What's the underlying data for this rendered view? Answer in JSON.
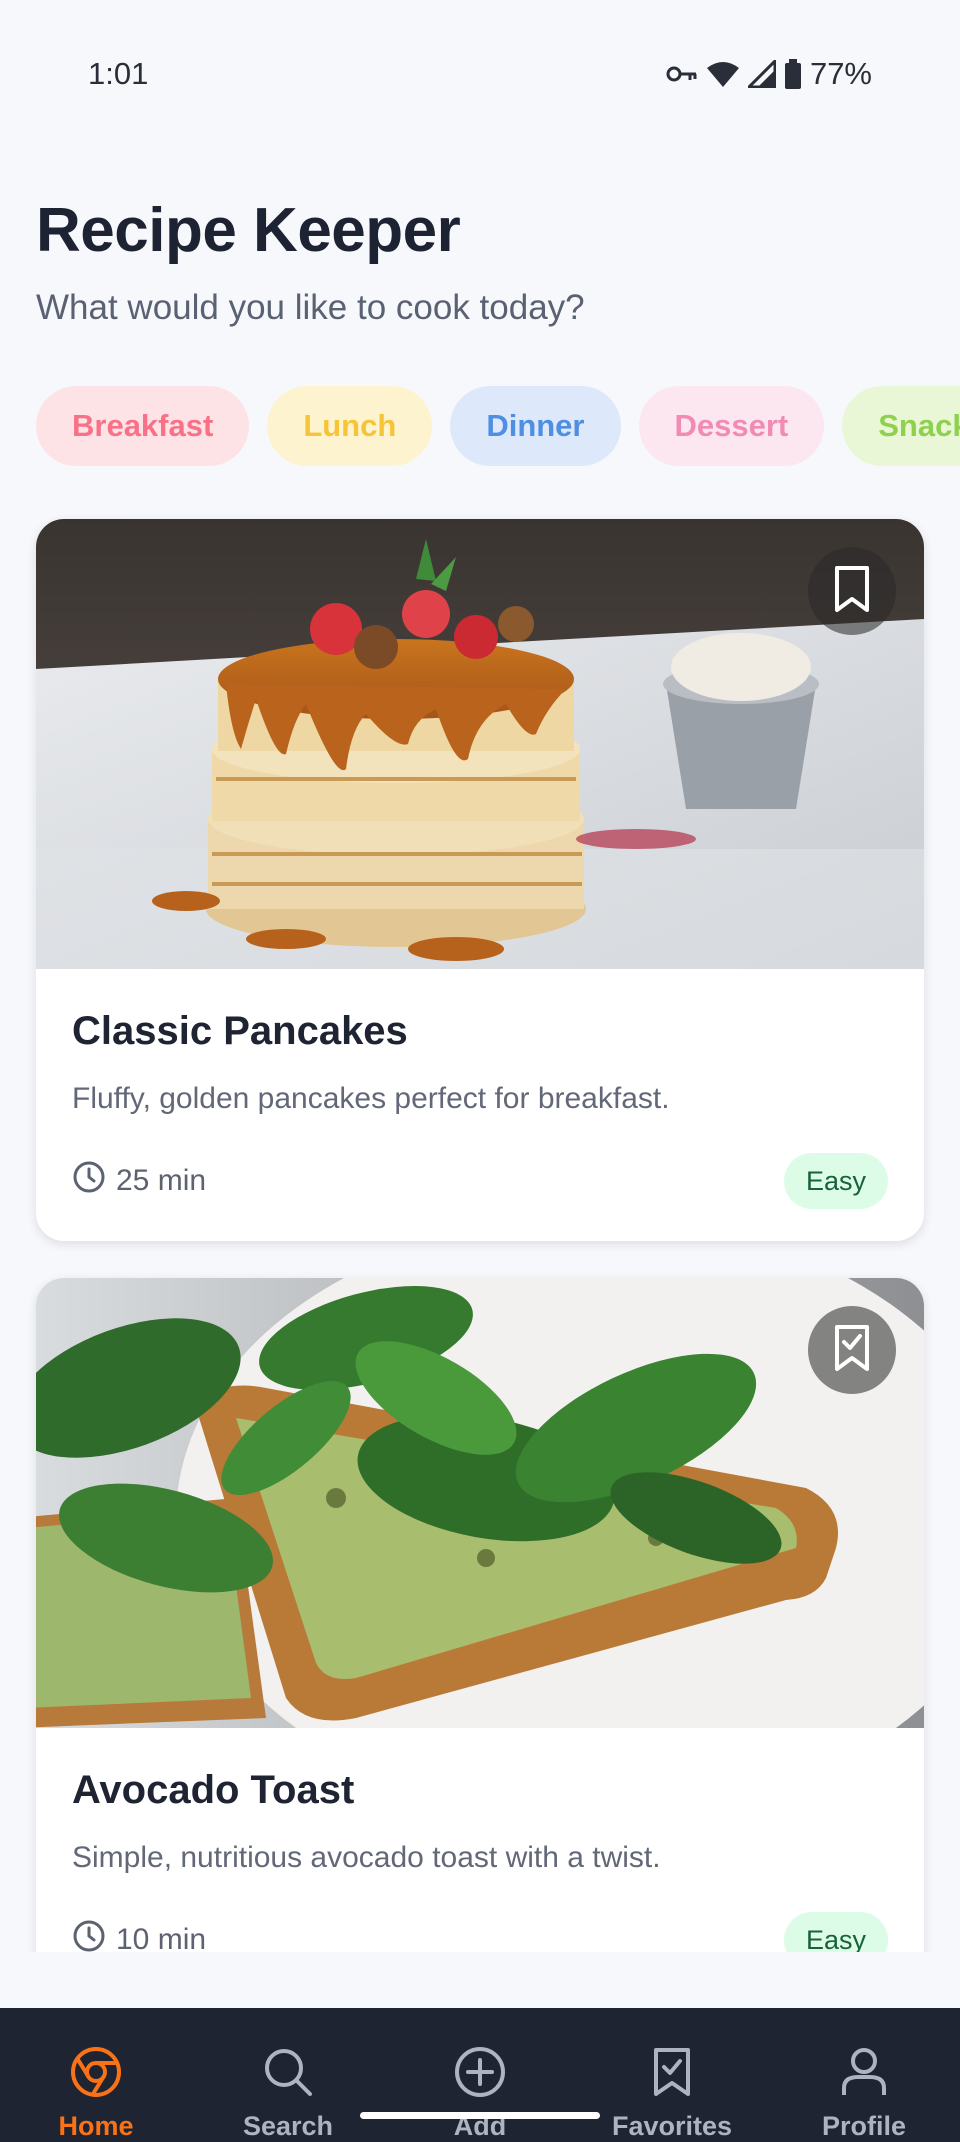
{
  "status_bar": {
    "time": "1:01",
    "battery": "77%"
  },
  "header": {
    "title": "Recipe Keeper",
    "subtitle": "What would you like to cook today?"
  },
  "categories": [
    {
      "label": "Breakfast",
      "bg": "#fde3e6",
      "fg": "#f87187"
    },
    {
      "label": "Lunch",
      "bg": "#fdf3cf",
      "fg": "#f5c438"
    },
    {
      "label": "Dinner",
      "bg": "#dde9fb",
      "fg": "#4e8fe3"
    },
    {
      "label": "Dessert",
      "bg": "#fce6ef",
      "fg": "#f28bb4"
    },
    {
      "label": "Snack",
      "bg": "#e9f7d6",
      "fg": "#8fd14f"
    }
  ],
  "recipes": [
    {
      "title": "Classic Pancakes",
      "description": "Fluffy, golden pancakes perfect for breakfast.",
      "time": "25 min",
      "difficulty": "Easy",
      "bookmark_icon": "bookmark-outline-icon"
    },
    {
      "title": "Avocado Toast",
      "description": "Simple, nutritious avocado toast with a twist.",
      "time": "10 min",
      "difficulty": "Easy",
      "bookmark_icon": "bookmark-check-icon"
    }
  ],
  "bottom_nav": [
    {
      "label": "Home",
      "icon": "home-chrome-icon",
      "active": true
    },
    {
      "label": "Search",
      "icon": "search-icon",
      "active": false
    },
    {
      "label": "Add",
      "icon": "add-circle-icon",
      "active": false
    },
    {
      "label": "Favorites",
      "icon": "bookmark-check-icon",
      "active": false
    },
    {
      "label": "Profile",
      "icon": "person-icon",
      "active": false
    }
  ],
  "colors": {
    "accent": "#f97316",
    "nav_bg": "#1f2433",
    "badge_bg": "#dcfce7",
    "badge_fg": "#17623a"
  }
}
